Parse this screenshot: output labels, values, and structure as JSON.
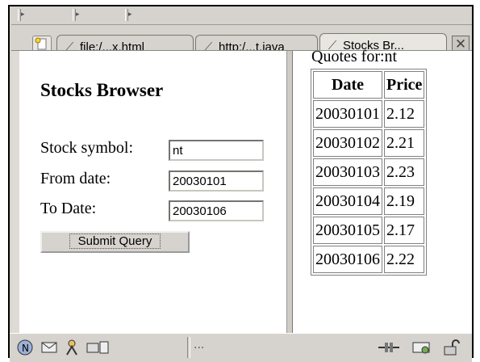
{
  "tabs": [
    {
      "label": "file:/...x.html",
      "icon": "document-link-icon"
    },
    {
      "label": "http:/...t.java",
      "icon": "document-link-icon"
    },
    {
      "label": "Stocks Br...",
      "icon": "document-link-icon",
      "active": true
    }
  ],
  "form": {
    "title": "Stocks Browser",
    "symbol_label": "Stock symbol:",
    "symbol_value": "nt",
    "from_label": "From date:",
    "from_value": "20030101",
    "to_label": "To Date:",
    "to_value": "20030106",
    "submit_label": "Submit Query"
  },
  "quotes": {
    "title": "Quotes for:nt",
    "headers": [
      "Date",
      "Price"
    ],
    "rows": [
      [
        "20030101",
        "2.12"
      ],
      [
        "20030102",
        "2.21"
      ],
      [
        "20030103",
        "2.23"
      ],
      [
        "20030104",
        "2.19"
      ],
      [
        "20030105",
        "2.17"
      ],
      [
        "20030106",
        "2.22"
      ]
    ]
  },
  "statusbar": {
    "more_label": "..."
  }
}
